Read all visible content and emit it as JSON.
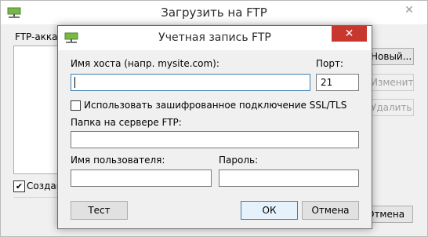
{
  "background_window": {
    "title": "Загрузить на FTP",
    "close_glyph": "✕",
    "app_icon": "network-drive-icon",
    "accounts_group_label": "FTP-аккау",
    "new_button": "Новый...",
    "edit_button": "Изменить...",
    "delete_button": "Удалить",
    "create_checkbox_label": "Создава",
    "cancel_button": "Отмена"
  },
  "dialog": {
    "title": "Учетная запись FTP",
    "icon": "network-drive-icon",
    "close_glyph": "✕",
    "host_label": "Имя хоста (напр. mysite.com):",
    "host_value": "",
    "port_label": "Порт:",
    "port_value": "21",
    "ssl_label": "Использовать зашифрованное подключение SSL/TLS",
    "ssl_checked": false,
    "folder_label": "Папка на сервере FTP:",
    "folder_value": "",
    "username_label": "Имя пользователя:",
    "username_value": "",
    "password_label": "Пароль:",
    "password_value": "",
    "test_button": "Тест",
    "ok_button": "ОК",
    "cancel_button": "Отмена"
  },
  "colors": {
    "accent": "#3c7fb1",
    "close_red": "#c7372e",
    "icon_green": "#7ab648"
  }
}
